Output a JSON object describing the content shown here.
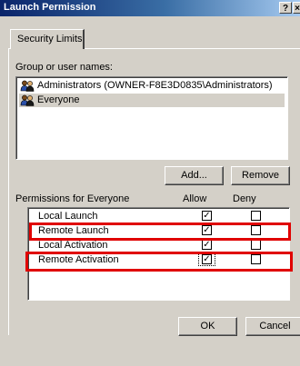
{
  "window": {
    "title": "Launch Permission",
    "help_glyph": "?",
    "close_glyph": "×"
  },
  "tabs": [
    {
      "label": "Security Limits"
    }
  ],
  "users_section": {
    "label": "Group or user names:",
    "items": [
      {
        "name": "Administrators (OWNER-F8E3D0835\\Administrators)",
        "icon": "user-group-icon",
        "selected": false
      },
      {
        "name": "Everyone",
        "icon": "user-group-icon",
        "selected": true
      }
    ]
  },
  "buttons": {
    "add": "Add...",
    "remove": "Remove",
    "ok": "OK",
    "cancel": "Cancel"
  },
  "permissions_section": {
    "label": "Permissions for Everyone",
    "allow_header": "Allow",
    "deny_header": "Deny",
    "items": [
      {
        "name": "Local Launch",
        "allow": true,
        "deny": false
      },
      {
        "name": "Remote Launch",
        "allow": true,
        "deny": false,
        "highlighted": true
      },
      {
        "name": "Local Activation",
        "allow": true,
        "deny": false
      },
      {
        "name": "Remote Activation",
        "allow": true,
        "deny": false,
        "highlighted": true
      }
    ]
  },
  "colors": {
    "highlight": "#e00000",
    "titlebar_start": "#0a246a",
    "face": "#d4d0c8"
  }
}
